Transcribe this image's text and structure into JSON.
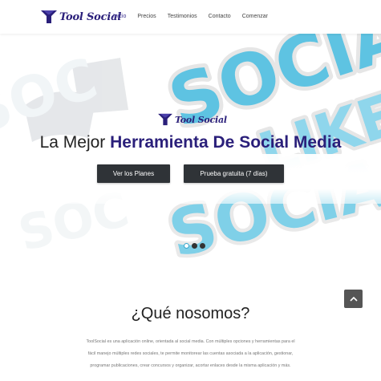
{
  "brand": {
    "name": "Tool Social",
    "color": "#2a1f7a"
  },
  "nav": {
    "items": [
      {
        "label": "Inicio"
      },
      {
        "label": "Precios"
      },
      {
        "label": "Testimonios"
      },
      {
        "label": "Contacto"
      },
      {
        "label": "Comenzar"
      }
    ]
  },
  "hero": {
    "logo_text": "Tool Social",
    "title_prefix": "La Mejor ",
    "title_strong": "Herramienta De Social Media",
    "buttons": {
      "plans_label": "Ver los Planes",
      "trial_label": "Prueba gratuita (7 días)"
    },
    "carousel": {
      "slide_count": 3,
      "active_index": 0
    },
    "accent_color": "#49b8d8"
  },
  "about": {
    "title": "¿Qué nosomos?",
    "lines": [
      "ToolSocial es una aplicación online, orientada al social media. Con múltiples opciones y herramientas para el",
      "fácil manejo múltiples redes sociales, te permite monitorear las cuentas asociada a la aplicación, gestionar,",
      "programar publicaciones, crear concursos y organizar, acortar enlaces desde la misma aplicación y más."
    ]
  },
  "icons": {
    "logo": "funnel-logo-icon",
    "scroll_top": "chevron-up-icon"
  }
}
